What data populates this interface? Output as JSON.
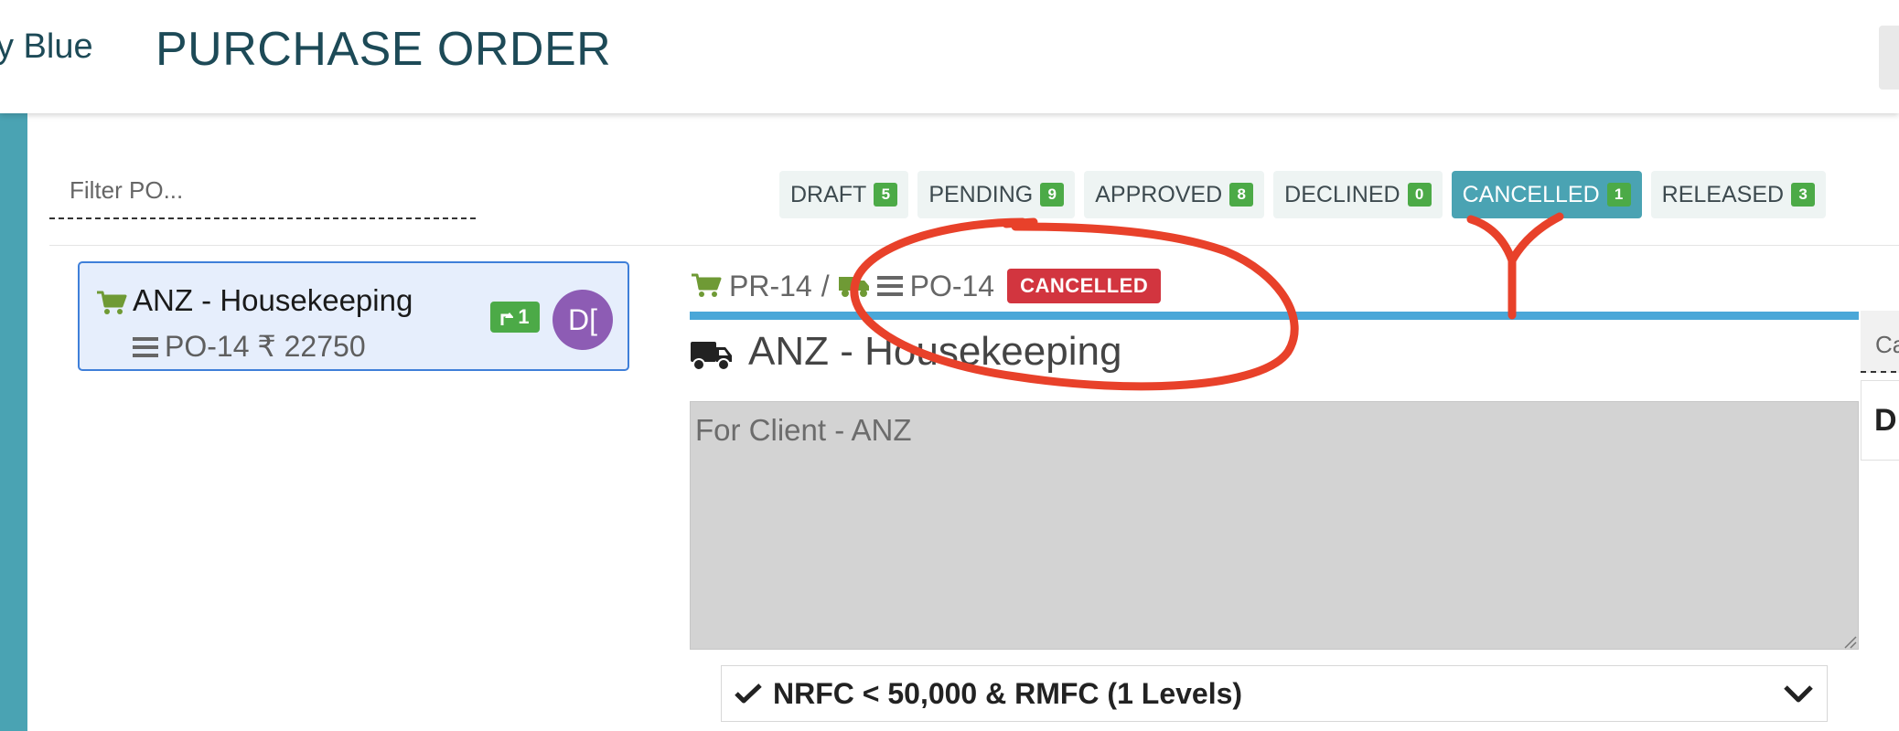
{
  "header": {
    "brand": "y Blue",
    "title": "PURCHASE ORDER"
  },
  "filter": {
    "placeholder": "Filter PO..."
  },
  "tabs": [
    {
      "label": "DRAFT",
      "count": "5"
    },
    {
      "label": "PENDING",
      "count": "9"
    },
    {
      "label": "APPROVED",
      "count": "8"
    },
    {
      "label": "DECLINED",
      "count": "0"
    },
    {
      "label": "CANCELLED",
      "count": "1",
      "active": true
    },
    {
      "label": "RELEASED",
      "count": "3"
    }
  ],
  "list_item": {
    "title": "ANZ - Housekeeping",
    "subtitle": "PO-14 ₹ 22750",
    "approval_count": "1",
    "avatar_initials": "D["
  },
  "detail": {
    "pr_ref": "PR-14",
    "separator": "/",
    "po_ref": "PO-14",
    "status": "CANCELLED",
    "title": "ANZ - Housekeeping",
    "notes": "For Client - ANZ",
    "approval_flow": "NRFC < 50,000 & RMFC (1 Levels)"
  },
  "side_panel": {
    "tab_label": "Ca",
    "box_text": "D"
  },
  "colors": {
    "teal": "#4aa3b3",
    "green": "#4caa47",
    "red": "#d2353f",
    "blue": "#4aa7d8",
    "annotation": "#e8412a"
  },
  "icons": [
    "cart-icon",
    "list-icon",
    "truck-icon",
    "check-icon",
    "chevron-down-icon",
    "approval-arrow-icon"
  ]
}
